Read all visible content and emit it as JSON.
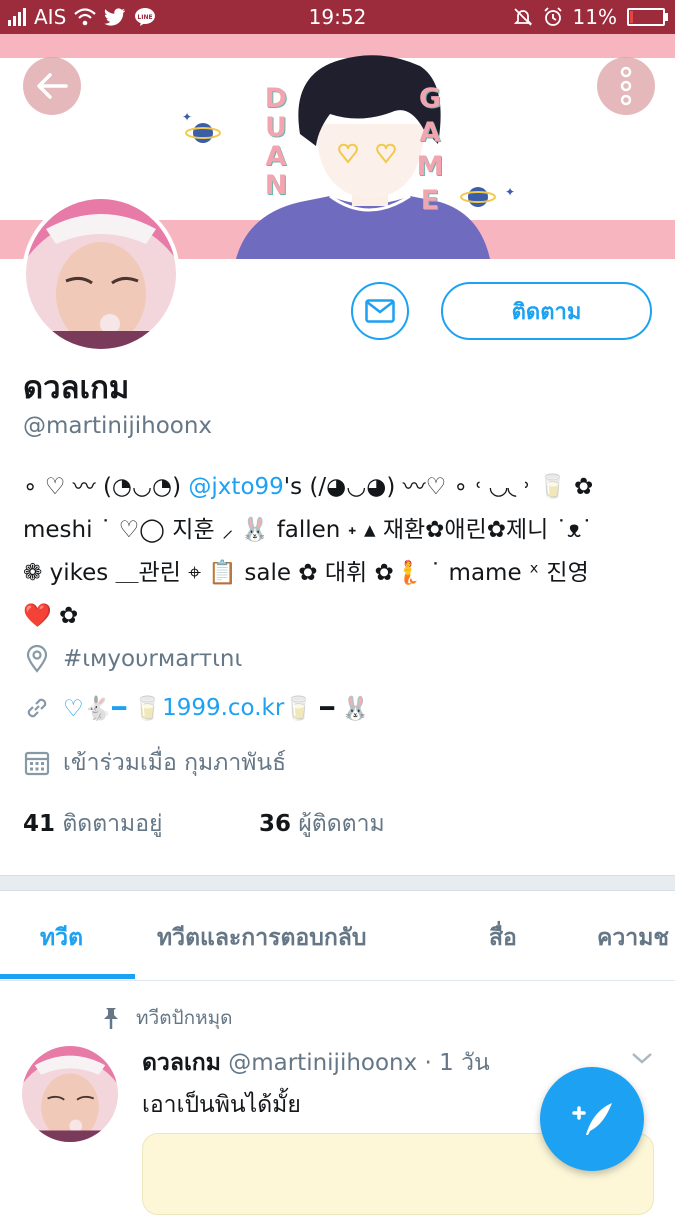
{
  "status_bar": {
    "carrier": "AIS",
    "time": "19:52",
    "battery": "11%",
    "battery_level": 0.11,
    "icons": [
      "signal-icon",
      "wifi-icon",
      "twitter-icon",
      "line-icon",
      "mute-bell-icon",
      "alarm-icon",
      "battery-icon"
    ]
  },
  "banner": {
    "text_left": "DUAN",
    "text_right": "GAME",
    "colors": {
      "stripe": "#f7b5bf",
      "shirt": "#6f6bbf",
      "hair": "#1f1f2e"
    }
  },
  "actions": {
    "follow_label": "ติดตาม"
  },
  "profile": {
    "name": "ดวลเกม",
    "handle": "@martinijihoonx",
    "bio": {
      "line1_pre": "∘ ♡ 〰 (◔◡◔) ",
      "line1_link": "@jxto99",
      "line1_post": "'s (/◕◡◕) 〰♡ ∘ ˓ ◟◞◟ ˒ 🥛 ✿",
      "line2": "meshi ˙ ♡◯ 지훈 ⸝ 🐰 fallen ˖ ▴ 재환✿애린✿제니 ˙ᴥ˙",
      "line3": "❁ yikes ＿관린 ⌖ 📋 sale ✿ 대휘 ✿🧜 ˙ mame ˣ 진영",
      "line4": "❤️ ✿"
    },
    "location": "#ɩмyoυrмarтɩnɩ",
    "website_pre": "♡🐇━ 🥛",
    "website_link": "1999.co.kr",
    "website_post": "🥛 ━ 🐰",
    "joined": "เข้าร่วมเมื่อ กุมภาพันธ์",
    "following_count": "41",
    "following_label": "ติดตามอยู่",
    "followers_count": "36",
    "followers_label": "ผู้ติดตาม"
  },
  "tabs": [
    {
      "label": "ทวีต",
      "active": true
    },
    {
      "label": "ทวีตและการตอบกลับ",
      "active": false
    },
    {
      "label": "สื่อ",
      "active": false
    },
    {
      "label": "ความช",
      "active": false
    }
  ],
  "pinned_tweet": {
    "pinned_label": "ทวีตปักหมุด",
    "name": "ดวลเกม",
    "handle_time": "@martinijihoonx · 1 วัน",
    "text": "เอาเป็นพินได้มั้ย"
  },
  "colors": {
    "accent": "#1da1f2",
    "status_bar": "#9c2b3c",
    "muted": "#657786"
  }
}
